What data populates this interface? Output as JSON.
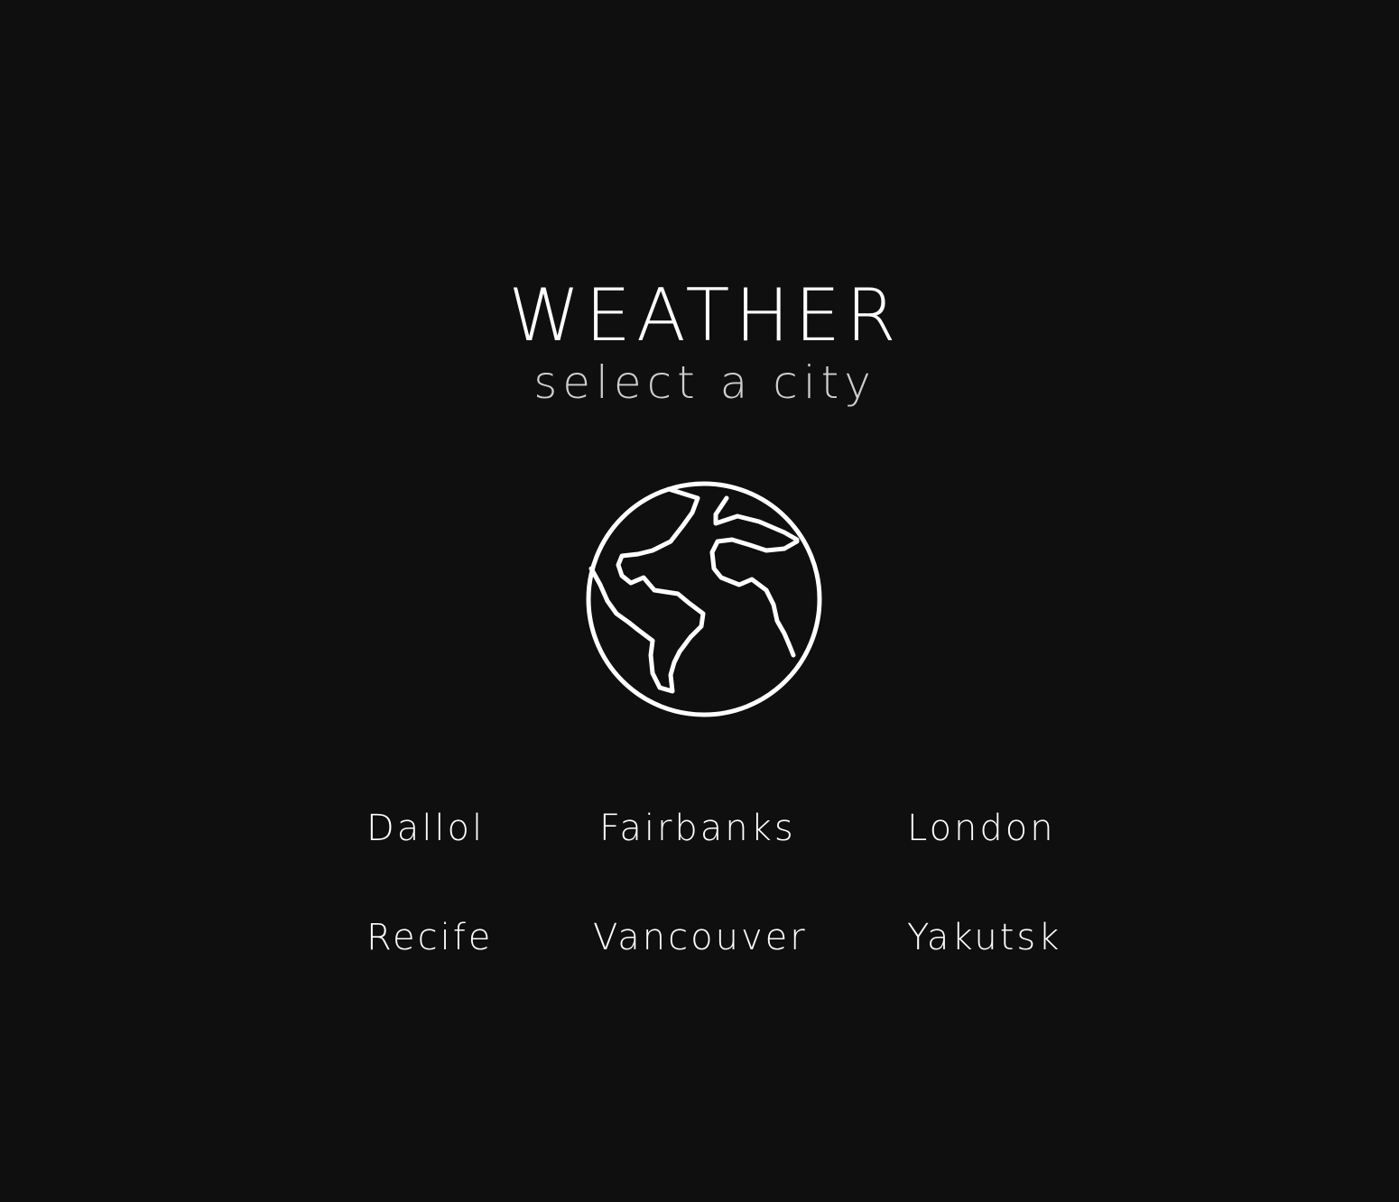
{
  "header": {
    "title": "WEATHER",
    "subtitle": "select a city"
  },
  "icon": {
    "name": "globe-icon",
    "stroke_color": "#ffffff"
  },
  "cities": [
    {
      "label": "Dallol"
    },
    {
      "label": "Fairbanks"
    },
    {
      "label": "London"
    },
    {
      "label": "Recife"
    },
    {
      "label": "Vancouver"
    },
    {
      "label": "Yakutsk"
    }
  ],
  "colors": {
    "background": "#0f0f0f",
    "text": "#ffffff",
    "subtitle": "#cfcfcf"
  }
}
